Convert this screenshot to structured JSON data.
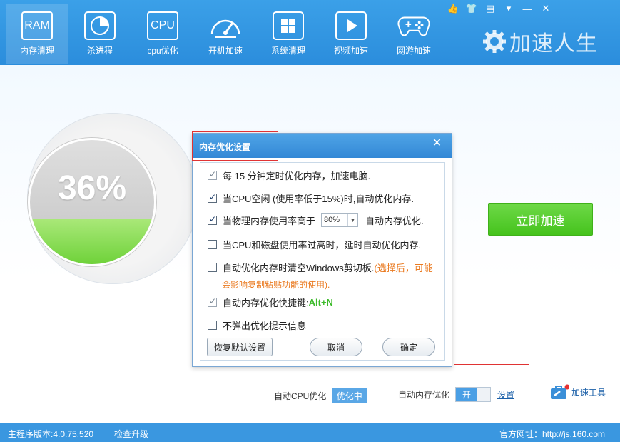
{
  "nav": [
    {
      "label": "内存清理",
      "icon": "ram-icon",
      "icon_text": "RAM",
      "active": true
    },
    {
      "label": "杀进程",
      "icon": "pie-chart-icon",
      "icon_text": ""
    },
    {
      "label": "cpu优化",
      "icon": "cpu-icon",
      "icon_text": "CPU"
    },
    {
      "label": "开机加速",
      "icon": "speedometer-icon",
      "icon_text": ""
    },
    {
      "label": "系统清理",
      "icon": "windows-icon",
      "icon_text": ""
    },
    {
      "label": "视频加速",
      "icon": "play-icon",
      "icon_text": ""
    },
    {
      "label": "网游加速",
      "icon": "gamepad-icon",
      "icon_text": ""
    }
  ],
  "brand": {
    "name": "加速人生"
  },
  "gauge": {
    "percent_text": "36%",
    "fill_fraction": 0.36
  },
  "accelerate_button": "立即加速",
  "auto_cpu": {
    "label": "自动CPU优化",
    "status": "优化中"
  },
  "auto_memory": {
    "label": "自动内存优化",
    "toggle": "开",
    "settings_link": "设置"
  },
  "tools_label": "加速工具",
  "statusbar": {
    "version": "主程序版本:4.0.75.520",
    "check_update": "检查升级",
    "website": "官方网址：http://js.160.com"
  },
  "dialog": {
    "title": "内存优化设置",
    "options": [
      {
        "text": "每 15 分钟定时优化内存，加速电脑.",
        "checked": true
      },
      {
        "text": "当CPU空闲 (使用率低于15%)时,自动优化内存.",
        "checked": true
      },
      {
        "text_before": "当物理内存使用率高于",
        "select_value": "80%",
        "text_after": "自动内存优化.",
        "checked": true
      },
      {
        "text": "当CPU和磁盘使用率过高时，延时自动优化内存.",
        "checked": false
      },
      {
        "text": "自动优化内存时清空Windows剪切板.",
        "warning": "(选择后，可能",
        "warning2": "会影响复制粘贴功能的使用).",
        "checked": false
      },
      {
        "text": "自动内存优化快捷键:",
        "hotkey": "Alt+N",
        "checked": true
      },
      {
        "text": "不弹出优化提示信息",
        "checked": false
      }
    ],
    "buttons": {
      "restore": "恢复默认设置",
      "cancel": "取消",
      "ok": "确定"
    }
  }
}
